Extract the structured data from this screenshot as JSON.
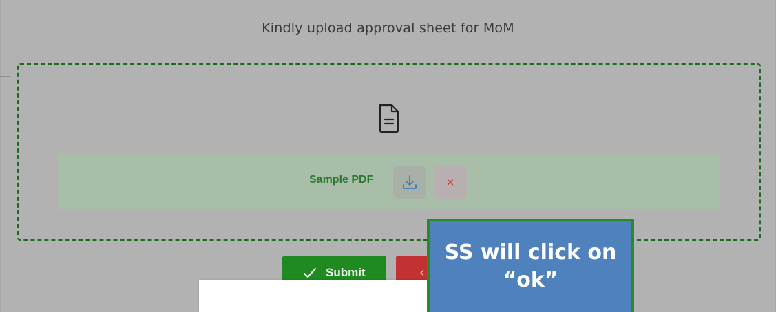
{
  "modal": {
    "title": "Kindly upload approval sheet for MoM"
  },
  "upload": {
    "file_icon": "document-icon",
    "file_name": "Sample PDF",
    "download_icon": "download-icon",
    "remove_icon": "close-icon",
    "remove_label": "×"
  },
  "actions": {
    "submit_label": "Submit",
    "submit_icon": "check-icon",
    "cancel_icon": "chevron-left-icon",
    "cancel_glyph": "‹"
  },
  "annotation": {
    "text": "SS will click on “ok”"
  },
  "colors": {
    "upload_border": "#1d6b1d",
    "file_name": "#2c7a31",
    "submit_bg": "#1f8a1f",
    "cancel_bg": "#c33232",
    "callout_bg": "#4f81bd",
    "callout_border": "#2a8a2a"
  }
}
